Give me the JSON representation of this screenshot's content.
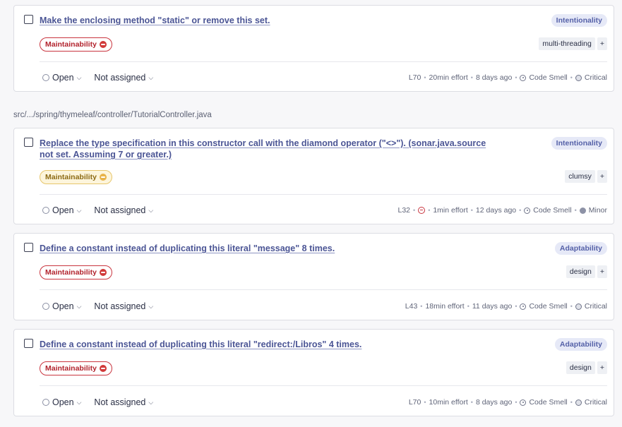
{
  "file_path": "src/.../spring/thymeleaf/controller/TutorialController.java",
  "issues": [
    {
      "title": "Make the enclosing method \"static\" or remove this set.",
      "attribute": "Intentionality",
      "impact": "Maintainability",
      "impact_severity": "high",
      "tags": [
        "multi-threading"
      ],
      "status": "Open",
      "assignee": "Not assigned",
      "line": "L70",
      "effort": "20min effort",
      "age": "8 days ago",
      "type": "Code Smell",
      "severity": "Critical"
    },
    {
      "title": "Replace the type specification in this constructor call with the diamond operator (\"<>\"). (sonar.java.source not set. Assuming 7 or greater.)",
      "attribute": "Intentionality",
      "impact": "Maintainability",
      "impact_severity": "medium",
      "tags": [
        "clumsy"
      ],
      "status": "Open",
      "assignee": "Not assigned",
      "line": "L32",
      "effort": "1min effort",
      "age": "12 days ago",
      "type": "Code Smell",
      "severity": "Minor"
    },
    {
      "title": "Define a constant instead of duplicating this literal \"message\" 8 times.",
      "attribute": "Adaptability",
      "impact": "Maintainability",
      "impact_severity": "high",
      "tags": [
        "design"
      ],
      "status": "Open",
      "assignee": "Not assigned",
      "line": "L43",
      "effort": "18min effort",
      "age": "11 days ago",
      "type": "Code Smell",
      "severity": "Critical"
    },
    {
      "title": "Define a constant instead of duplicating this literal \"redirect:/Libros\" 4 times.",
      "attribute": "Adaptability",
      "impact": "Maintainability",
      "impact_severity": "high",
      "tags": [
        "design"
      ],
      "status": "Open",
      "assignee": "Not assigned",
      "line": "L70",
      "effort": "10min effort",
      "age": "8 days ago",
      "type": "Code Smell",
      "severity": "Critical"
    }
  ],
  "tag_add_label": "+",
  "icons": {
    "status": "circle-icon",
    "chevron": "chevron-down-icon",
    "type": "code-smell-icon",
    "severity_critical": "critical-severity-icon",
    "severity_minor": "minor-severity-icon",
    "quick_fix": "quick-fix-icon"
  },
  "colors": {
    "link": "#4b5595",
    "impact_high": "#c9353f",
    "impact_medium": "#e7c66b",
    "attribute_badge_bg": "#e6e9f7"
  }
}
